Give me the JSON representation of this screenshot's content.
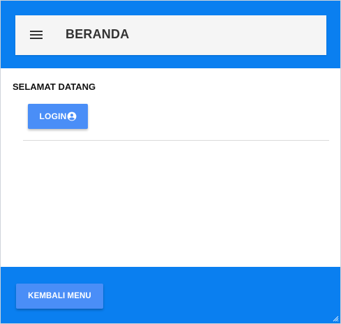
{
  "header": {
    "menu_icon": "hamburger-menu-icon",
    "title": "BERANDA"
  },
  "main": {
    "welcome_text": "SELAMAT DATANG",
    "login_button": {
      "label": "LOGIN",
      "icon": "account-circle-icon"
    }
  },
  "footer": {
    "back_button_label": "KEMBALI MENU"
  },
  "colors": {
    "header_bg": "#0a7ff0",
    "toolbar_bg": "#f5f5f5",
    "button_bg": "#4a8ef7",
    "text_dark": "#333333"
  }
}
